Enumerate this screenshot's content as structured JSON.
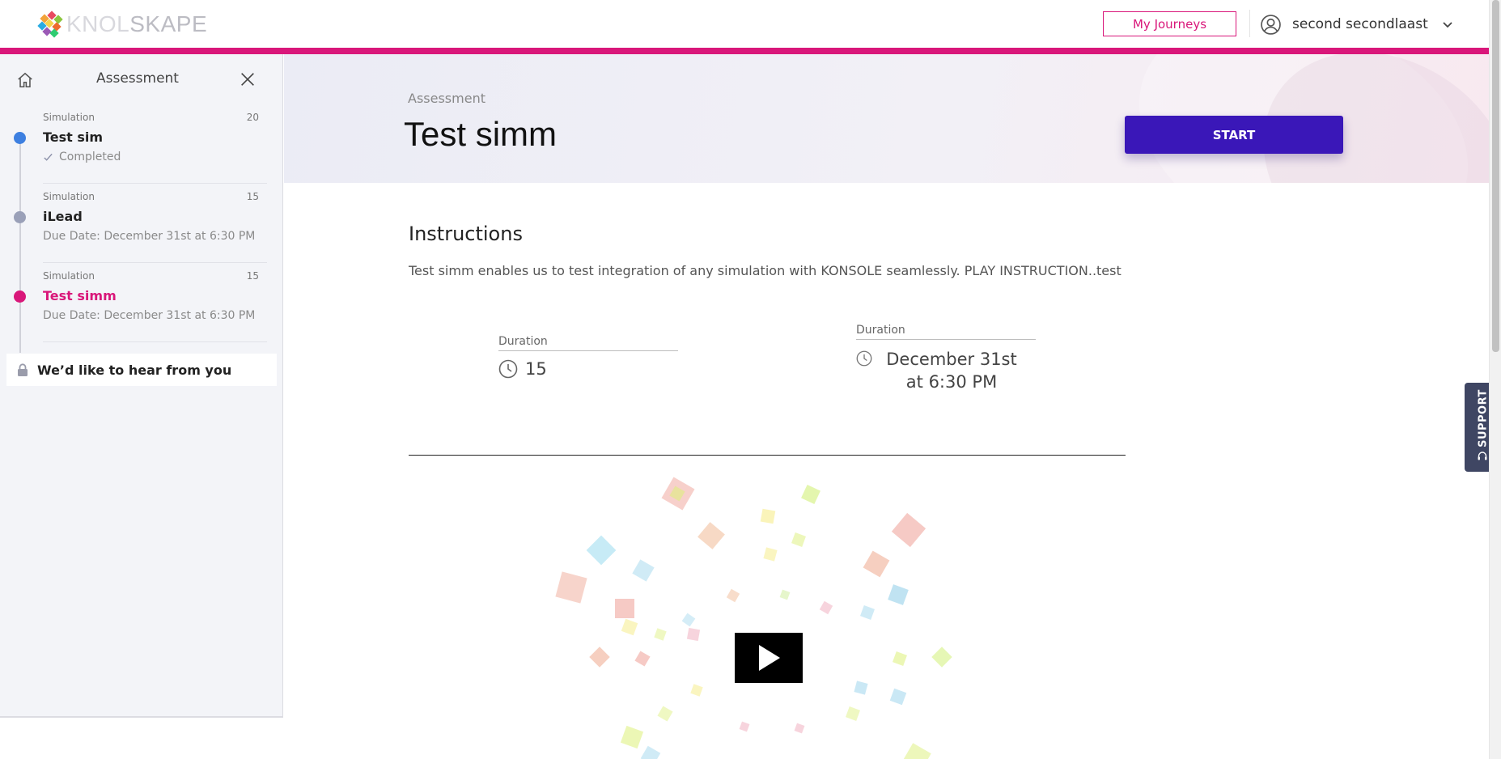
{
  "header": {
    "logo_text": "KNOLSKAPE",
    "my_journeys_label": "My Journeys",
    "user_name": "second secondlaast",
    "accent_color": "#d9177a"
  },
  "sidebar": {
    "title": "Assessment",
    "items": [
      {
        "type": "Simulation",
        "score": "20",
        "name": "Test sim",
        "meta": "Completed",
        "status": "completed",
        "dot_color": "#3d7fe0"
      },
      {
        "type": "Simulation",
        "score": "15",
        "name": "iLead",
        "meta": "Due Date: December 31st at 6:30 PM",
        "status": "pending",
        "dot_color": "#9aa0b8"
      },
      {
        "type": "Simulation",
        "score": "15",
        "name": "Test simm",
        "meta": "Due Date: December 31st at 6:30 PM",
        "status": "active",
        "dot_color": "#d9177a"
      }
    ],
    "feedback_label": "We’d like to hear from you"
  },
  "hero": {
    "breadcrumb": "Assessment",
    "title": "Test simm",
    "start_label": "START",
    "start_color": "#3a17b8"
  },
  "instructions": {
    "heading": "Instructions",
    "text": "Test simm enables us to test integration of any simulation with KONSOLE seamlessly. PLAY INSTRUCTION..test"
  },
  "info": {
    "duration_label": "Duration",
    "duration_value": "15",
    "due_label": "Duration",
    "due_value": "December 31st at 6:30 PM"
  },
  "video": {
    "play_icon": "play-icon"
  },
  "support": {
    "label": "SUPPORT"
  }
}
